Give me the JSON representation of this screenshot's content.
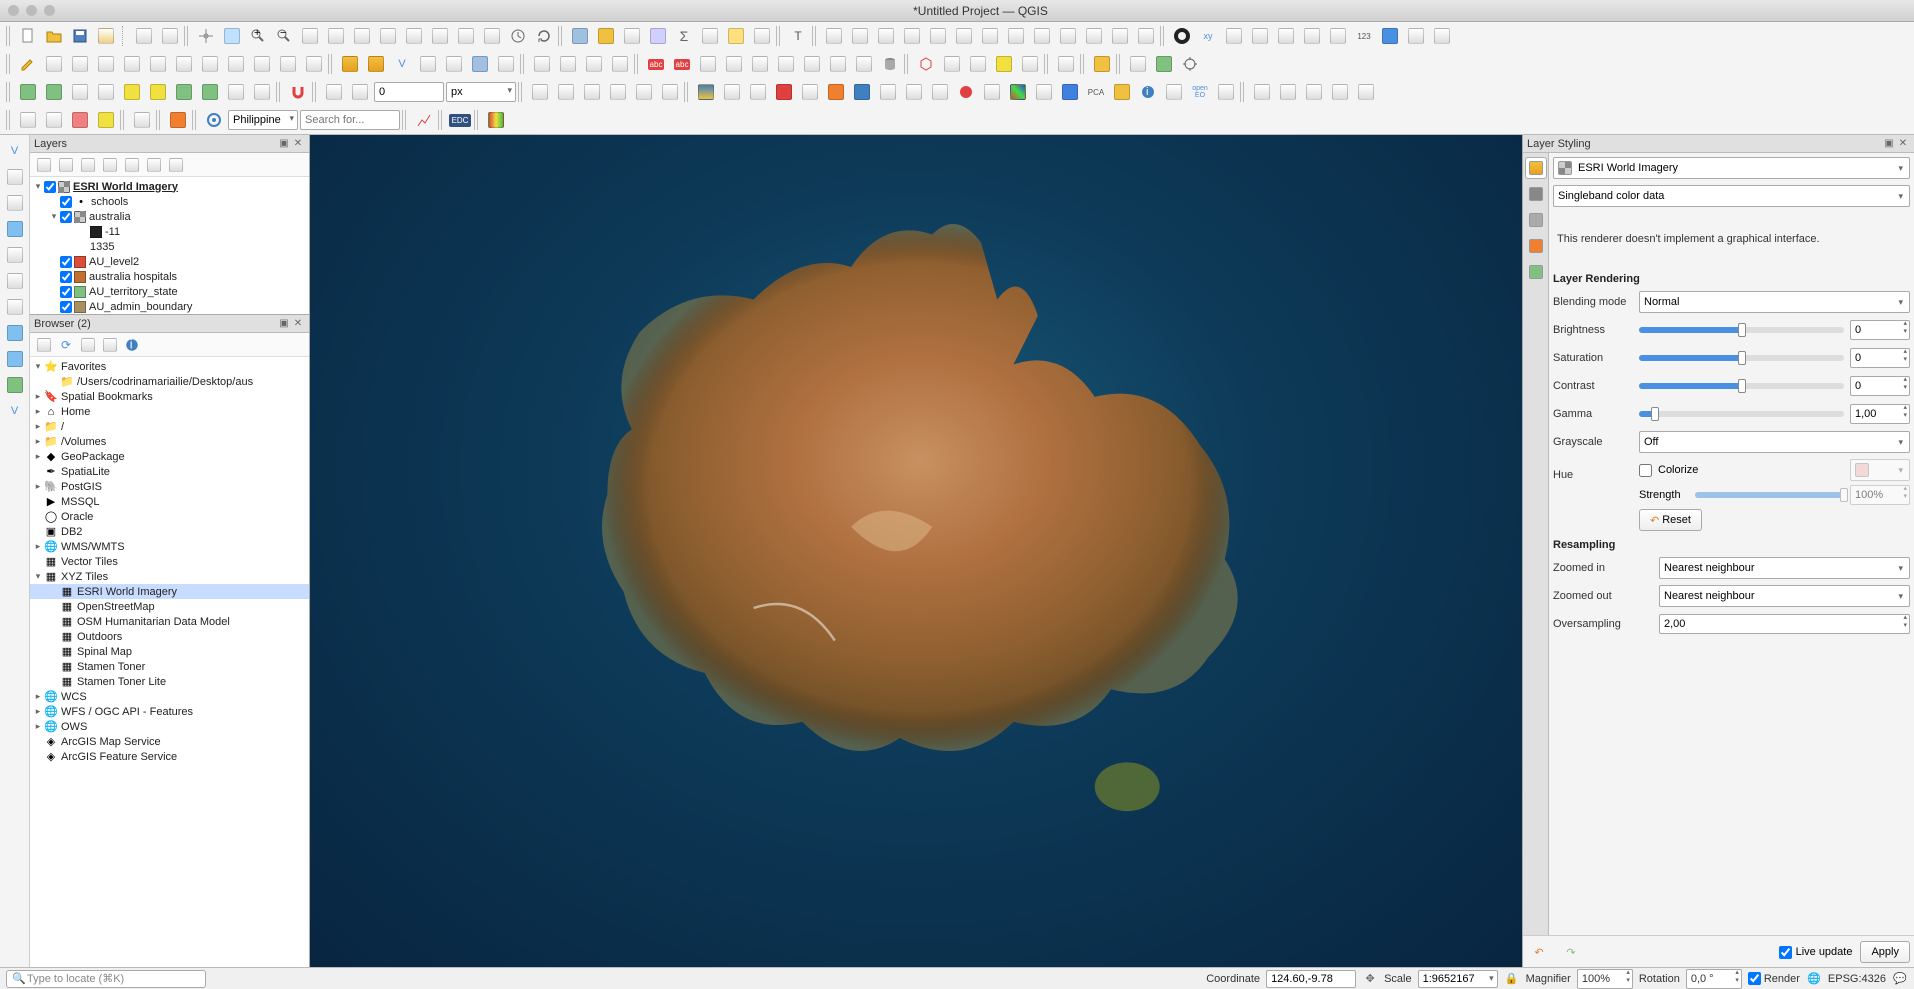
{
  "window": {
    "title": "*Untitled Project — QGIS"
  },
  "toolbar": {
    "region_select": "Philippines",
    "search_placeholder": "Search for...",
    "spin_value": "0",
    "unit": "px"
  },
  "panels": {
    "layers": {
      "title": "Layers",
      "items": [
        {
          "label": "ESRI World Imagery",
          "checked": true,
          "exp": "▾",
          "bold": true,
          "type": "raster"
        },
        {
          "label": "schools",
          "checked": true,
          "indent": 1,
          "type": "point"
        },
        {
          "label": "australia",
          "checked": true,
          "exp": "▾",
          "indent": 1,
          "type": "raster"
        },
        {
          "label": "-11",
          "indent": 2,
          "swatch": "#222"
        },
        {
          "label": "1335",
          "indent": 2
        },
        {
          "label": "AU_level2",
          "checked": true,
          "indent": 1,
          "swatch": "#d94f3a"
        },
        {
          "label": "australia hospitals",
          "checked": true,
          "indent": 1,
          "swatch": "#c07030"
        },
        {
          "label": "AU_territory_state",
          "checked": true,
          "indent": 1,
          "swatch": "#7fbf7f"
        },
        {
          "label": "AU_admin_boundary",
          "checked": true,
          "indent": 1,
          "swatch": "#a89060"
        }
      ]
    },
    "browser": {
      "title": "Browser (2)",
      "items": [
        {
          "label": "Favorites",
          "exp": "▾",
          "icon": "star"
        },
        {
          "label": "/Users/codrinamariailie/Desktop/aus",
          "indent": 1,
          "icon": "folder"
        },
        {
          "label": "Spatial Bookmarks",
          "exp": "▸",
          "icon": "bookmark"
        },
        {
          "label": "Home",
          "exp": "▸",
          "icon": "home"
        },
        {
          "label": "/",
          "exp": "▸",
          "icon": "folder"
        },
        {
          "label": "/Volumes",
          "exp": "▸",
          "icon": "folder"
        },
        {
          "label": "GeoPackage",
          "exp": "▸",
          "icon": "gpkg"
        },
        {
          "label": "SpatiaLite",
          "icon": "feather"
        },
        {
          "label": "PostGIS",
          "exp": "▸",
          "icon": "elephant"
        },
        {
          "label": "MSSQL",
          "icon": "mssql"
        },
        {
          "label": "Oracle",
          "icon": "oracle"
        },
        {
          "label": "DB2",
          "icon": "db2"
        },
        {
          "label": "WMS/WMTS",
          "exp": "▸",
          "icon": "globe"
        },
        {
          "label": "Vector Tiles",
          "icon": "grid"
        },
        {
          "label": "XYZ Tiles",
          "exp": "▾",
          "icon": "grid"
        },
        {
          "label": "ESRI World Imagery",
          "indent": 1,
          "icon": "grid",
          "selected": true
        },
        {
          "label": "OpenStreetMap",
          "indent": 1,
          "icon": "grid"
        },
        {
          "label": "OSM Humanitarian Data Model",
          "indent": 1,
          "icon": "grid"
        },
        {
          "label": "Outdoors",
          "indent": 1,
          "icon": "grid"
        },
        {
          "label": "Spinal Map",
          "indent": 1,
          "icon": "grid"
        },
        {
          "label": "Stamen Toner",
          "indent": 1,
          "icon": "grid"
        },
        {
          "label": "Stamen Toner Lite",
          "indent": 1,
          "icon": "grid"
        },
        {
          "label": "WCS",
          "exp": "▸",
          "icon": "globe"
        },
        {
          "label": "WFS / OGC API - Features",
          "exp": "▸",
          "icon": "globe"
        },
        {
          "label": "OWS",
          "exp": "▸",
          "icon": "globe"
        },
        {
          "label": "ArcGIS Map Service",
          "icon": "arcgis"
        },
        {
          "label": "ArcGIS Feature Service",
          "icon": "arcgis"
        }
      ]
    }
  },
  "styling": {
    "title": "Layer Styling",
    "layer": "ESRI World Imagery",
    "renderer": "Singleband color data",
    "renderer_msg": "This renderer doesn't implement a graphical interface.",
    "section_rendering": "Layer Rendering",
    "blending_label": "Blending mode",
    "blending_value": "Normal",
    "brightness_label": "Brightness",
    "brightness_value": "0",
    "saturation_label": "Saturation",
    "saturation_value": "0",
    "contrast_label": "Contrast",
    "contrast_value": "0",
    "gamma_label": "Gamma",
    "gamma_value": "1,00",
    "grayscale_label": "Grayscale",
    "grayscale_value": "Off",
    "hue_label": "Hue",
    "colorize_label": "Colorize",
    "strength_label": "Strength",
    "strength_value": "100%",
    "reset_label": "Reset",
    "section_resampling": "Resampling",
    "zoomed_in_label": "Zoomed in",
    "zoomed_in_value": "Nearest neighbour",
    "zoomed_out_label": "Zoomed out",
    "zoomed_out_value": "Nearest neighbour",
    "oversampling_label": "Oversampling",
    "oversampling_value": "2,00",
    "live_update_label": "Live update",
    "apply_label": "Apply"
  },
  "statusbar": {
    "locator_placeholder": "Type to locate (⌘K)",
    "coord_label": "Coordinate",
    "coord_value": "124.60,-9.78",
    "scale_label": "Scale",
    "scale_value": "1:9652167",
    "magnifier_label": "Magnifier",
    "magnifier_value": "100%",
    "rotation_label": "Rotation",
    "rotation_value": "0,0 °",
    "render_label": "Render",
    "crs_label": "EPSG:4326"
  }
}
